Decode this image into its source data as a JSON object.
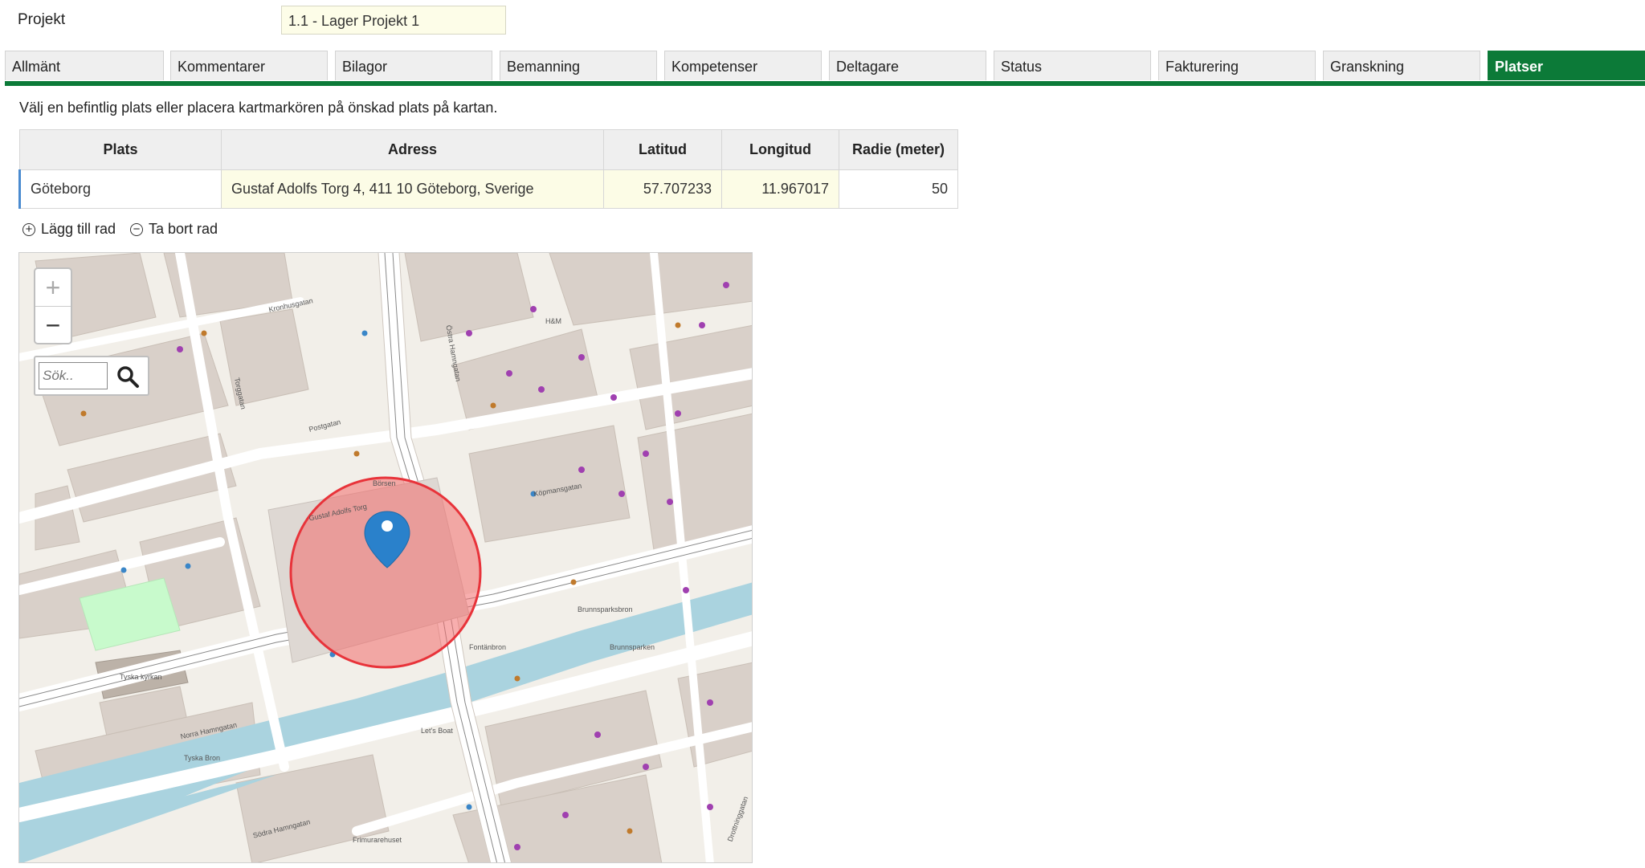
{
  "project": {
    "label": "Projekt",
    "value": "1.1 - Lager Projekt 1"
  },
  "tabs": [
    {
      "label": "Allmänt"
    },
    {
      "label": "Kommentarer"
    },
    {
      "label": "Bilagor"
    },
    {
      "label": "Bemanning"
    },
    {
      "label": "Kompetenser"
    },
    {
      "label": "Deltagare"
    },
    {
      "label": "Status"
    },
    {
      "label": "Fakturering"
    },
    {
      "label": "Granskning"
    },
    {
      "label": "Platser",
      "active": true
    }
  ],
  "instruction": "Välj en befintlig plats eller placera kartmarkören på önskad plats på kartan.",
  "table": {
    "headers": [
      "Plats",
      "Adress",
      "Latitud",
      "Longitud",
      "Radie (meter)"
    ],
    "rows": [
      {
        "plats": "Göteborg",
        "adress": "Gustaf Adolfs Torg 4, 411 10 Göteborg, Sverige",
        "lat": "57.707233",
        "lon": "11.967017",
        "radie": "50"
      }
    ]
  },
  "row_controls": {
    "add": "Lägg till rad",
    "remove": "Ta bort rad"
  },
  "map": {
    "zoom_in": "+",
    "zoom_out": "−",
    "search_placeholder": "Sök..",
    "labels": {
      "gustaf_adolfs_torg": "Gustaf Adolfs Torg",
      "postgatan": "Postgatan",
      "kopmansgatan": "Köpmansgatan",
      "kronhusgatan": "Kronhusgatan",
      "torggatan": "Torggatan",
      "norra_hamngatan": "Norra Hamngatan",
      "sodra_hamngatan": "Södra Hamngatan",
      "ostra_hamngatan": "Östra Hamngatan",
      "fontanbron": "Fontänbron",
      "brunnsparksbron": "Brunnsparksbron",
      "brunnsparken": "Brunnsparken",
      "tyska_bron": "Tyska Bron",
      "tyska_kyrkan": "Tyska kyrkan",
      "frimurarehuset": "Frimurarehuset",
      "drottninggatan": "Drottninggatan",
      "lilla_bommen": "Let's Boat",
      "hm": "H&M",
      "borsen": "Börsen"
    },
    "colors": {
      "water": "#aad3df",
      "road": "#ffffff",
      "block": "#e0d9cf",
      "park": "#c8facc",
      "radius_fill": "#f36b6b",
      "radius_stroke": "#e8333a",
      "marker": "#2a81cb"
    }
  }
}
